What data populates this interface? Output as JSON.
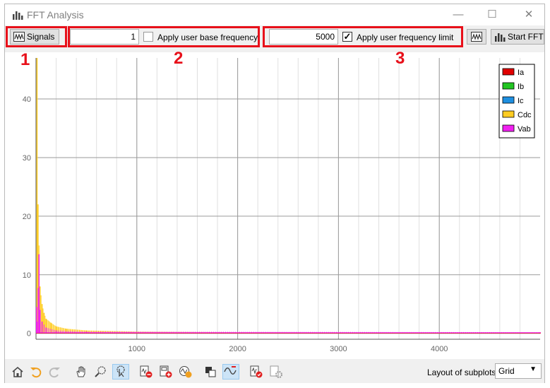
{
  "window": {
    "title": "FFT Analysis"
  },
  "toolbar": {
    "signals_label": "Signals",
    "base_freq_value": "1",
    "base_freq_checkbox_label": "Apply user base frequency",
    "base_freq_checked": false,
    "freq_limit_value": "5000",
    "freq_limit_checkbox_label": "Apply user frequency limit",
    "freq_limit_checked": true,
    "start_fft_label": "Start FFT"
  },
  "annotations": {
    "box1": "1",
    "box2": "2",
    "box3": "3"
  },
  "legend": [
    {
      "label": "Ia",
      "color": "#e00000"
    },
    {
      "label": "Ib",
      "color": "#22c522"
    },
    {
      "label": "Ic",
      "color": "#1e8fe0"
    },
    {
      "label": "Cdc",
      "color": "#ffcc22"
    },
    {
      "label": "Vab",
      "color": "#f020f0"
    }
  ],
  "chart_data": {
    "type": "bar",
    "x_ticks": [
      1000,
      2000,
      3000,
      4000
    ],
    "y_ticks": [
      0,
      10,
      20,
      30,
      40
    ],
    "xlim": [
      0,
      5000
    ],
    "ylim": [
      -1,
      47
    ],
    "grid": true,
    "legend_position": "top-right",
    "series": [
      {
        "name": "Cdc",
        "color": "#ffcc22",
        "x": [
          10,
          20,
          40,
          60,
          80,
          100,
          150,
          200,
          300,
          500,
          1000,
          2000,
          5000
        ],
        "values": [
          47,
          22,
          8,
          5,
          3.5,
          2.5,
          1.8,
          1.2,
          0.8,
          0.5,
          0.3,
          0.2,
          0.1
        ]
      },
      {
        "name": "Vab",
        "color": "#f020f0",
        "x": [
          5,
          10,
          30,
          40,
          60,
          100,
          200,
          500,
          5000
        ],
        "values": [
          4.5,
          2,
          13.5,
          4,
          2,
          1,
          0.5,
          0.3,
          0.2
        ]
      },
      {
        "name": "Ia",
        "color": "#e00000",
        "x": [
          5000
        ],
        "values": [
          0.1
        ]
      }
    ]
  },
  "bottom": {
    "layout_label": "Layout of subplots",
    "layout_value": "Grid"
  }
}
